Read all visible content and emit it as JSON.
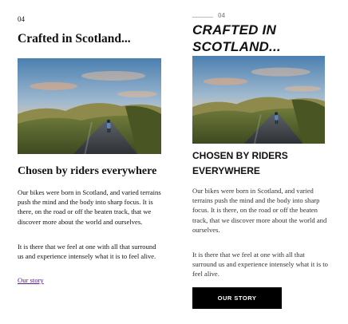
{
  "left_panel": {
    "number": "04",
    "title": "Crafted in Scotland...",
    "photo_icon": "cyclist-landscape-photo",
    "heading": "Chosen by riders everywhere",
    "paragraph_1": "Our bikes were born in Scotland, and varied terrains push the mind and the body into sharp focus. It is there, on the road or off the beaten track, that we discover more about the world and ourselves.",
    "paragraph_2": "It is there that we feel at one with all that surround us and experience intensely what it is to feel alive.",
    "link_label": "Our story"
  },
  "right_panel": {
    "number": "04",
    "title": "Crafted in Scotland...",
    "photo_icon": "cyclist-landscape-photo",
    "heading": "Chosen by riders everywhere",
    "paragraph_1": "Our bikes were born in Scotland, and varied terrains push the mind and the body into sharp focus. It is there, on the road or off the beaten track, that we discover more about the world and ourselves.",
    "paragraph_2": "It is there that we feel at one with all that surround us and experience intensely what it is to feel alive.",
    "button_label": "Our story"
  },
  "colors": {
    "button_bg": "#000000",
    "button_text": "#ffffff",
    "link": "#551a8b"
  }
}
